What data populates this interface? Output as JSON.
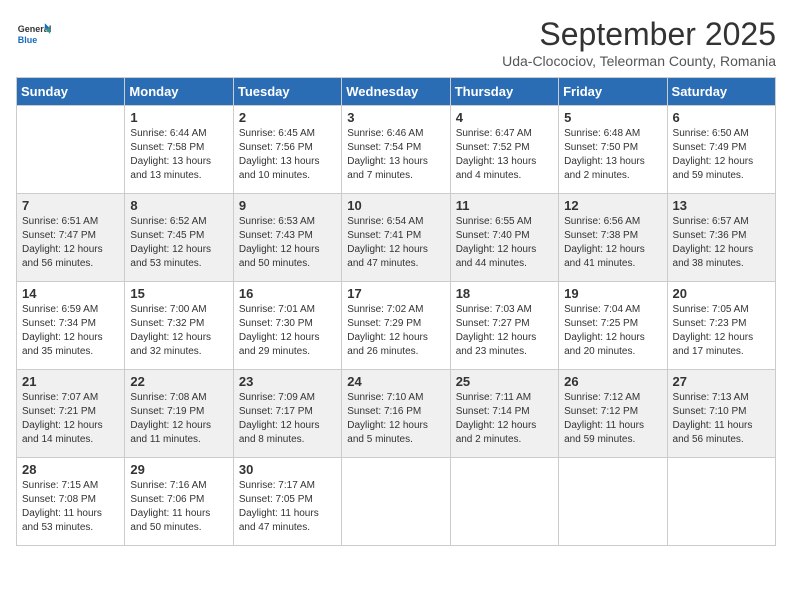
{
  "header": {
    "logo_general": "General",
    "logo_blue": "Blue",
    "month": "September 2025",
    "subtitle": "Uda-Clocociov, Teleorman County, Romania"
  },
  "days_of_week": [
    "Sunday",
    "Monday",
    "Tuesday",
    "Wednesday",
    "Thursday",
    "Friday",
    "Saturday"
  ],
  "weeks": [
    [
      {
        "day": "",
        "data": ""
      },
      {
        "day": "1",
        "data": "Sunrise: 6:44 AM\nSunset: 7:58 PM\nDaylight: 13 hours and 13 minutes."
      },
      {
        "day": "2",
        "data": "Sunrise: 6:45 AM\nSunset: 7:56 PM\nDaylight: 13 hours and 10 minutes."
      },
      {
        "day": "3",
        "data": "Sunrise: 6:46 AM\nSunset: 7:54 PM\nDaylight: 13 hours and 7 minutes."
      },
      {
        "day": "4",
        "data": "Sunrise: 6:47 AM\nSunset: 7:52 PM\nDaylight: 13 hours and 4 minutes."
      },
      {
        "day": "5",
        "data": "Sunrise: 6:48 AM\nSunset: 7:50 PM\nDaylight: 13 hours and 2 minutes."
      },
      {
        "day": "6",
        "data": "Sunrise: 6:50 AM\nSunset: 7:49 PM\nDaylight: 12 hours and 59 minutes."
      }
    ],
    [
      {
        "day": "7",
        "data": "Sunrise: 6:51 AM\nSunset: 7:47 PM\nDaylight: 12 hours and 56 minutes."
      },
      {
        "day": "8",
        "data": "Sunrise: 6:52 AM\nSunset: 7:45 PM\nDaylight: 12 hours and 53 minutes."
      },
      {
        "day": "9",
        "data": "Sunrise: 6:53 AM\nSunset: 7:43 PM\nDaylight: 12 hours and 50 minutes."
      },
      {
        "day": "10",
        "data": "Sunrise: 6:54 AM\nSunset: 7:41 PM\nDaylight: 12 hours and 47 minutes."
      },
      {
        "day": "11",
        "data": "Sunrise: 6:55 AM\nSunset: 7:40 PM\nDaylight: 12 hours and 44 minutes."
      },
      {
        "day": "12",
        "data": "Sunrise: 6:56 AM\nSunset: 7:38 PM\nDaylight: 12 hours and 41 minutes."
      },
      {
        "day": "13",
        "data": "Sunrise: 6:57 AM\nSunset: 7:36 PM\nDaylight: 12 hours and 38 minutes."
      }
    ],
    [
      {
        "day": "14",
        "data": "Sunrise: 6:59 AM\nSunset: 7:34 PM\nDaylight: 12 hours and 35 minutes."
      },
      {
        "day": "15",
        "data": "Sunrise: 7:00 AM\nSunset: 7:32 PM\nDaylight: 12 hours and 32 minutes."
      },
      {
        "day": "16",
        "data": "Sunrise: 7:01 AM\nSunset: 7:30 PM\nDaylight: 12 hours and 29 minutes."
      },
      {
        "day": "17",
        "data": "Sunrise: 7:02 AM\nSunset: 7:29 PM\nDaylight: 12 hours and 26 minutes."
      },
      {
        "day": "18",
        "data": "Sunrise: 7:03 AM\nSunset: 7:27 PM\nDaylight: 12 hours and 23 minutes."
      },
      {
        "day": "19",
        "data": "Sunrise: 7:04 AM\nSunset: 7:25 PM\nDaylight: 12 hours and 20 minutes."
      },
      {
        "day": "20",
        "data": "Sunrise: 7:05 AM\nSunset: 7:23 PM\nDaylight: 12 hours and 17 minutes."
      }
    ],
    [
      {
        "day": "21",
        "data": "Sunrise: 7:07 AM\nSunset: 7:21 PM\nDaylight: 12 hours and 14 minutes."
      },
      {
        "day": "22",
        "data": "Sunrise: 7:08 AM\nSunset: 7:19 PM\nDaylight: 12 hours and 11 minutes."
      },
      {
        "day": "23",
        "data": "Sunrise: 7:09 AM\nSunset: 7:17 PM\nDaylight: 12 hours and 8 minutes."
      },
      {
        "day": "24",
        "data": "Sunrise: 7:10 AM\nSunset: 7:16 PM\nDaylight: 12 hours and 5 minutes."
      },
      {
        "day": "25",
        "data": "Sunrise: 7:11 AM\nSunset: 7:14 PM\nDaylight: 12 hours and 2 minutes."
      },
      {
        "day": "26",
        "data": "Sunrise: 7:12 AM\nSunset: 7:12 PM\nDaylight: 11 hours and 59 minutes."
      },
      {
        "day": "27",
        "data": "Sunrise: 7:13 AM\nSunset: 7:10 PM\nDaylight: 11 hours and 56 minutes."
      }
    ],
    [
      {
        "day": "28",
        "data": "Sunrise: 7:15 AM\nSunset: 7:08 PM\nDaylight: 11 hours and 53 minutes."
      },
      {
        "day": "29",
        "data": "Sunrise: 7:16 AM\nSunset: 7:06 PM\nDaylight: 11 hours and 50 minutes."
      },
      {
        "day": "30",
        "data": "Sunrise: 7:17 AM\nSunset: 7:05 PM\nDaylight: 11 hours and 47 minutes."
      },
      {
        "day": "",
        "data": ""
      },
      {
        "day": "",
        "data": ""
      },
      {
        "day": "",
        "data": ""
      },
      {
        "day": "",
        "data": ""
      }
    ]
  ]
}
